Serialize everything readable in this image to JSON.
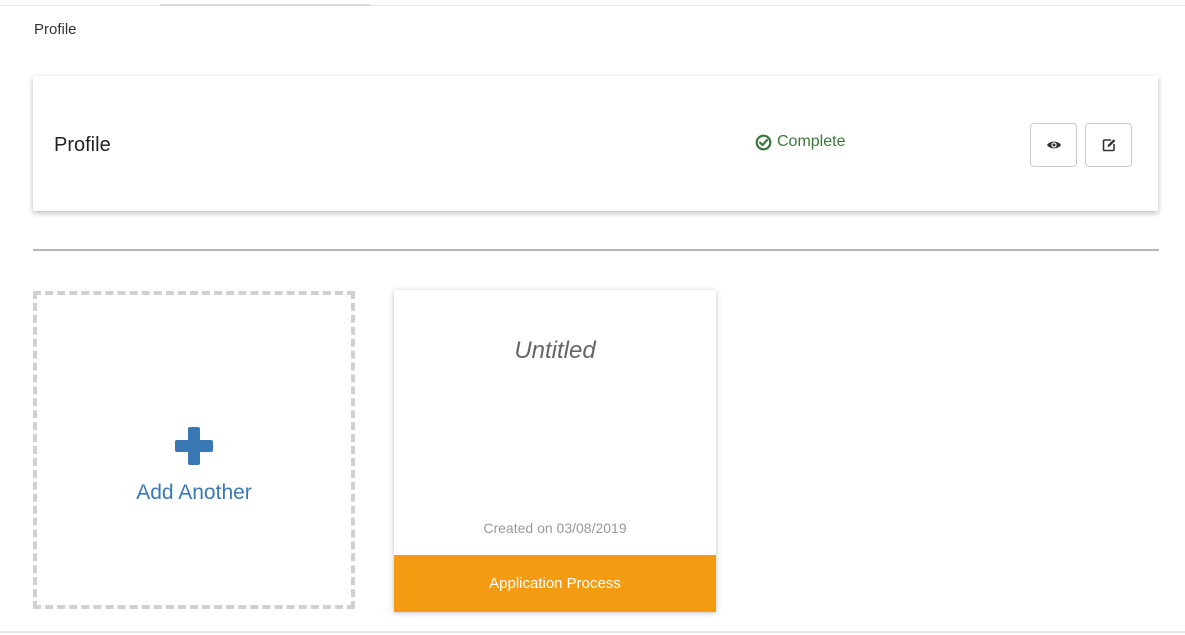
{
  "breadcrumb": "Profile",
  "profile_section": {
    "title": "Profile",
    "status": "Complete",
    "status_color": "#3c763d",
    "status_icon": "check-circle-icon",
    "actions": [
      {
        "icon": "eye-icon"
      },
      {
        "icon": "edit-icon"
      }
    ]
  },
  "add_card": {
    "label": "Add Another",
    "icon": "plus-icon",
    "accent_color": "#3a78b5"
  },
  "application_card": {
    "title": "Untitled",
    "created": "Created on 03/08/2019",
    "footer_label": "Application Process",
    "footer_color": "#f39c12"
  }
}
